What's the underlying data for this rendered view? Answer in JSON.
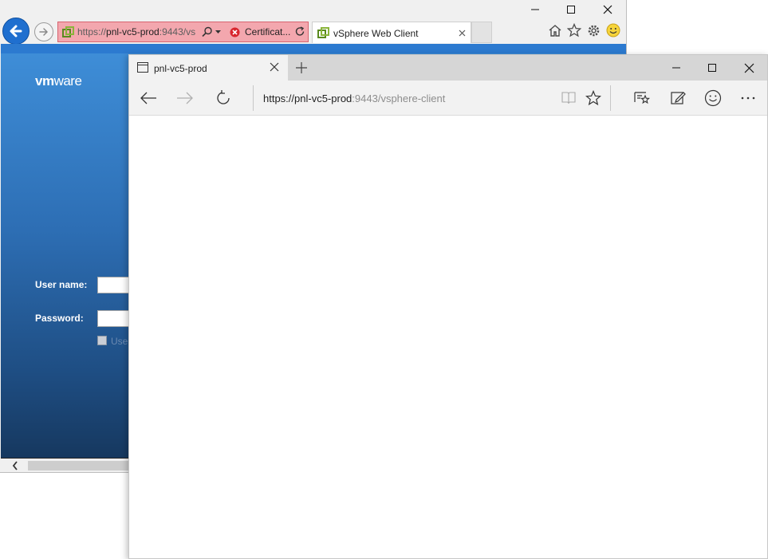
{
  "ie_window": {
    "address": {
      "scheme": "https://",
      "host": "pnl-vc5-prod",
      "rest": ":9443/vs"
    },
    "certificate_error": "Certificat...",
    "tab_title": "vSphere Web Client",
    "page": {
      "logo_vm": "vm",
      "logo_ware": "ware",
      "username_label": "User name:",
      "password_label": "Password:",
      "sspi_label": "Use"
    },
    "colors": {
      "address_error_bg": "#f3a7ae",
      "content_gradient_top": "#3f8fd9",
      "content_gradient_bottom": "#16385f"
    }
  },
  "edge_window": {
    "tab_title": "pnl-vc5-prod",
    "address": {
      "scheme": "https://",
      "host": "pnl-vc5-prod",
      "rest": ":9443/vsphere-client"
    },
    "toolbar_icons": [
      "back-icon",
      "forward-icon",
      "refresh-icon",
      "reading-view-icon",
      "favorite-star-icon",
      "hub-icon",
      "web-note-icon",
      "feedback-smiley-icon",
      "more-icon"
    ]
  }
}
